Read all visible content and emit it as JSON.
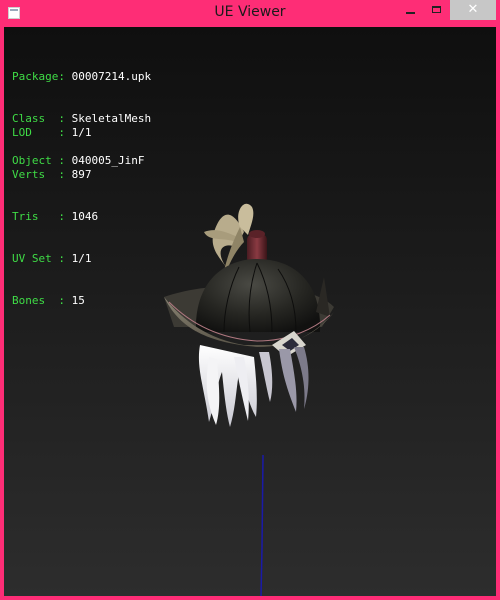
{
  "window": {
    "title": "UE Viewer",
    "accent_color": "#fe2d76",
    "controls": {
      "minimize": "minimize-icon",
      "maximize": "maximize-icon",
      "close": "close-icon"
    }
  },
  "info": {
    "object_rows": [
      {
        "label": "Package: ",
        "value": "00007214.upk"
      },
      {
        "label": "Class  : ",
        "value": "SkeletalMesh"
      },
      {
        "label": "Object : ",
        "value": "040005_JinF"
      }
    ],
    "stats_rows": [
      {
        "label": "LOD    : ",
        "value": "1/1"
      },
      {
        "label": "Verts  : ",
        "value": "897"
      },
      {
        "label": "Tris   : ",
        "value": "1046"
      },
      {
        "label": "UV Set : ",
        "value": "1/1"
      },
      {
        "label": "Bones  : ",
        "value": "15"
      }
    ],
    "label_color": "#3fdc46",
    "value_color": "#ffffff"
  },
  "scene": {
    "model": "hat-with-hair-mesh",
    "axis_color": "#1a1aa8"
  }
}
